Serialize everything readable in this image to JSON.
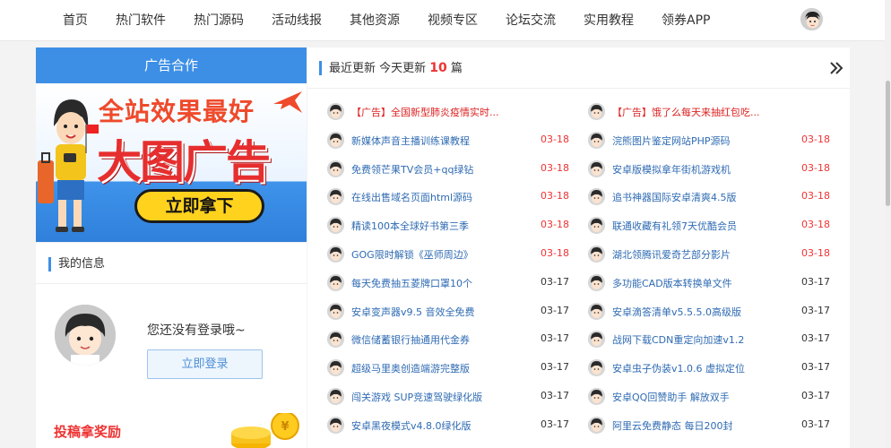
{
  "nav": {
    "items": [
      {
        "label": "首页"
      },
      {
        "label": "热门软件"
      },
      {
        "label": "热门源码"
      },
      {
        "label": "活动线报"
      },
      {
        "label": "其他资源"
      },
      {
        "label": "视频专区"
      },
      {
        "label": "论坛交流"
      },
      {
        "label": "实用教程"
      },
      {
        "label": "领券APP"
      }
    ]
  },
  "ad": {
    "header": "广告合作",
    "line1": "全站效果最好",
    "line2": "大图广告",
    "cta": "立即拿下"
  },
  "info": {
    "title": "我的信息",
    "status": "您还没有登录哦~",
    "login_button": "立即登录",
    "contribute": "投稿拿奖励"
  },
  "updates": {
    "title_prefix": "最近更新 今天更新",
    "today_count": "10",
    "title_suffix": "篇",
    "col1": [
      {
        "title": "【广告】全国新型肺炎疫情实时...",
        "date": "",
        "ad": true
      },
      {
        "title": "新媒体声音主播训练课教程",
        "date": "03-18"
      },
      {
        "title": "免费领芒果TV会员+qq绿钻",
        "date": "03-18"
      },
      {
        "title": "在线出售域名页面html源码",
        "date": "03-18"
      },
      {
        "title": "精读100本全球好书第三季",
        "date": "03-18"
      },
      {
        "title": "GOG限时解锁《巫师周边》",
        "date": "03-18"
      },
      {
        "title": "每天免费抽五菱牌口罩10个",
        "date": "03-17"
      },
      {
        "title": "安卓变声器v9.5 音效全免费",
        "date": "03-17"
      },
      {
        "title": "微信储蓄银行抽通用代金券",
        "date": "03-17"
      },
      {
        "title": "超级马里奥创造端游完整版",
        "date": "03-17"
      },
      {
        "title": "闯关游戏 SUP竞速驾驶绿化版",
        "date": "03-17"
      },
      {
        "title": "安卓黑夜模式v4.8.0绿化版",
        "date": "03-17"
      }
    ],
    "col2": [
      {
        "title": "【广告】饿了么每天来抽红包吃...",
        "date": "",
        "ad": true
      },
      {
        "title": "浣熊图片鉴定网站PHP源码",
        "date": "03-18"
      },
      {
        "title": "安卓版模拟拿年街机游戏机",
        "date": "03-18"
      },
      {
        "title": "追书神器国际安卓清爽4.5版",
        "date": "03-18"
      },
      {
        "title": "联通收藏有礼领7天优酷会员",
        "date": "03-18"
      },
      {
        "title": "湖北领腾讯爱奇艺部分影片",
        "date": "03-18"
      },
      {
        "title": "多功能CAD版本转换单文件",
        "date": "03-17"
      },
      {
        "title": "安卓滴答清单v5.5.5.0高级版",
        "date": "03-17"
      },
      {
        "title": "战网下载CDN重定向加速v1.2",
        "date": "03-17"
      },
      {
        "title": "安卓虫子伪装v1.0.6 虚拟定位",
        "date": "03-17"
      },
      {
        "title": "安卓QQ回赞助手 解放双手",
        "date": "03-17"
      },
      {
        "title": "阿里云免费静态 每日200封",
        "date": "03-17"
      }
    ]
  },
  "colors": {
    "accent": "#3d8fe5",
    "red": "#e33333",
    "link": "#2f6bb3"
  }
}
